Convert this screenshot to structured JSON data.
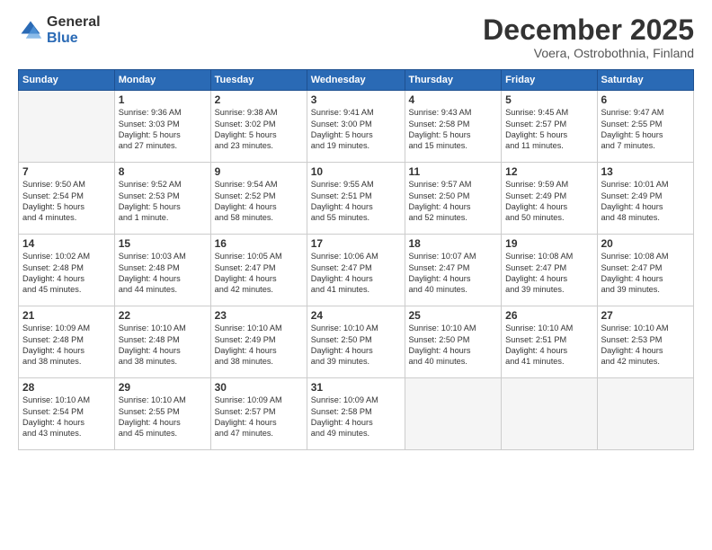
{
  "logo": {
    "general": "General",
    "blue": "Blue"
  },
  "title": "December 2025",
  "location": "Voera, Ostrobothnia, Finland",
  "days_header": [
    "Sunday",
    "Monday",
    "Tuesday",
    "Wednesday",
    "Thursday",
    "Friday",
    "Saturday"
  ],
  "weeks": [
    [
      {
        "day": "",
        "info": ""
      },
      {
        "day": "1",
        "info": "Sunrise: 9:36 AM\nSunset: 3:03 PM\nDaylight: 5 hours\nand 27 minutes."
      },
      {
        "day": "2",
        "info": "Sunrise: 9:38 AM\nSunset: 3:02 PM\nDaylight: 5 hours\nand 23 minutes."
      },
      {
        "day": "3",
        "info": "Sunrise: 9:41 AM\nSunset: 3:00 PM\nDaylight: 5 hours\nand 19 minutes."
      },
      {
        "day": "4",
        "info": "Sunrise: 9:43 AM\nSunset: 2:58 PM\nDaylight: 5 hours\nand 15 minutes."
      },
      {
        "day": "5",
        "info": "Sunrise: 9:45 AM\nSunset: 2:57 PM\nDaylight: 5 hours\nand 11 minutes."
      },
      {
        "day": "6",
        "info": "Sunrise: 9:47 AM\nSunset: 2:55 PM\nDaylight: 5 hours\nand 7 minutes."
      }
    ],
    [
      {
        "day": "7",
        "info": "Sunrise: 9:50 AM\nSunset: 2:54 PM\nDaylight: 5 hours\nand 4 minutes."
      },
      {
        "day": "8",
        "info": "Sunrise: 9:52 AM\nSunset: 2:53 PM\nDaylight: 5 hours\nand 1 minute."
      },
      {
        "day": "9",
        "info": "Sunrise: 9:54 AM\nSunset: 2:52 PM\nDaylight: 4 hours\nand 58 minutes."
      },
      {
        "day": "10",
        "info": "Sunrise: 9:55 AM\nSunset: 2:51 PM\nDaylight: 4 hours\nand 55 minutes."
      },
      {
        "day": "11",
        "info": "Sunrise: 9:57 AM\nSunset: 2:50 PM\nDaylight: 4 hours\nand 52 minutes."
      },
      {
        "day": "12",
        "info": "Sunrise: 9:59 AM\nSunset: 2:49 PM\nDaylight: 4 hours\nand 50 minutes."
      },
      {
        "day": "13",
        "info": "Sunrise: 10:01 AM\nSunset: 2:49 PM\nDaylight: 4 hours\nand 48 minutes."
      }
    ],
    [
      {
        "day": "14",
        "info": "Sunrise: 10:02 AM\nSunset: 2:48 PM\nDaylight: 4 hours\nand 45 minutes."
      },
      {
        "day": "15",
        "info": "Sunrise: 10:03 AM\nSunset: 2:48 PM\nDaylight: 4 hours\nand 44 minutes."
      },
      {
        "day": "16",
        "info": "Sunrise: 10:05 AM\nSunset: 2:47 PM\nDaylight: 4 hours\nand 42 minutes."
      },
      {
        "day": "17",
        "info": "Sunrise: 10:06 AM\nSunset: 2:47 PM\nDaylight: 4 hours\nand 41 minutes."
      },
      {
        "day": "18",
        "info": "Sunrise: 10:07 AM\nSunset: 2:47 PM\nDaylight: 4 hours\nand 40 minutes."
      },
      {
        "day": "19",
        "info": "Sunrise: 10:08 AM\nSunset: 2:47 PM\nDaylight: 4 hours\nand 39 minutes."
      },
      {
        "day": "20",
        "info": "Sunrise: 10:08 AM\nSunset: 2:47 PM\nDaylight: 4 hours\nand 39 minutes."
      }
    ],
    [
      {
        "day": "21",
        "info": "Sunrise: 10:09 AM\nSunset: 2:48 PM\nDaylight: 4 hours\nand 38 minutes."
      },
      {
        "day": "22",
        "info": "Sunrise: 10:10 AM\nSunset: 2:48 PM\nDaylight: 4 hours\nand 38 minutes."
      },
      {
        "day": "23",
        "info": "Sunrise: 10:10 AM\nSunset: 2:49 PM\nDaylight: 4 hours\nand 38 minutes."
      },
      {
        "day": "24",
        "info": "Sunrise: 10:10 AM\nSunset: 2:50 PM\nDaylight: 4 hours\nand 39 minutes."
      },
      {
        "day": "25",
        "info": "Sunrise: 10:10 AM\nSunset: 2:50 PM\nDaylight: 4 hours\nand 40 minutes."
      },
      {
        "day": "26",
        "info": "Sunrise: 10:10 AM\nSunset: 2:51 PM\nDaylight: 4 hours\nand 41 minutes."
      },
      {
        "day": "27",
        "info": "Sunrise: 10:10 AM\nSunset: 2:53 PM\nDaylight: 4 hours\nand 42 minutes."
      }
    ],
    [
      {
        "day": "28",
        "info": "Sunrise: 10:10 AM\nSunset: 2:54 PM\nDaylight: 4 hours\nand 43 minutes."
      },
      {
        "day": "29",
        "info": "Sunrise: 10:10 AM\nSunset: 2:55 PM\nDaylight: 4 hours\nand 45 minutes."
      },
      {
        "day": "30",
        "info": "Sunrise: 10:09 AM\nSunset: 2:57 PM\nDaylight: 4 hours\nand 47 minutes."
      },
      {
        "day": "31",
        "info": "Sunrise: 10:09 AM\nSunset: 2:58 PM\nDaylight: 4 hours\nand 49 minutes."
      },
      {
        "day": "",
        "info": ""
      },
      {
        "day": "",
        "info": ""
      },
      {
        "day": "",
        "info": ""
      }
    ]
  ]
}
